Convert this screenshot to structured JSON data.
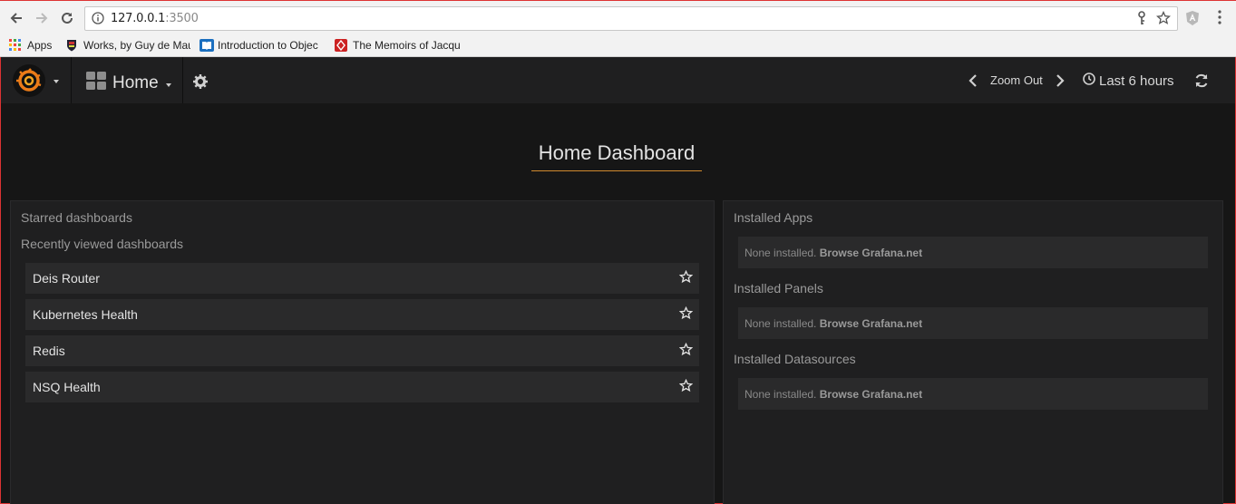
{
  "browser": {
    "url_host": "127.0.0.1",
    "url_port": ":3500",
    "icons": [
      "back-icon",
      "forward-icon",
      "reload-icon",
      "info-icon",
      "key-icon",
      "bookmark-star-icon",
      "extension-icon",
      "menu-icon"
    ]
  },
  "bookmarks": [
    {
      "label": "Apps",
      "icon": "apps-grid-icon"
    },
    {
      "label": "Works, by Guy de Mau",
      "icon": "shield-icon"
    },
    {
      "label": "Introduction to Objec",
      "icon": "book-icon"
    },
    {
      "label": "The Memoirs of Jacqu",
      "icon": "gutenberg-icon"
    }
  ],
  "grafana": {
    "home_label": "Home",
    "zoom_label": "Zoom Out",
    "time_label": "Last 6 hours",
    "dashboard_title": "Home Dashboard",
    "starred_heading": "Starred dashboards",
    "recent_heading": "Recently viewed dashboards",
    "recent_dashboards": [
      "Deis Router",
      "Kubernetes Health",
      "Redis",
      "NSQ Health"
    ],
    "installed": [
      {
        "heading": "Installed Apps",
        "empty_text": "None installed.",
        "link_text": "Browse Grafana.net"
      },
      {
        "heading": "Installed Panels",
        "empty_text": "None installed.",
        "link_text": "Browse Grafana.net"
      },
      {
        "heading": "Installed Datasources",
        "empty_text": "None installed.",
        "link_text": "Browse Grafana.net"
      }
    ],
    "colors": {
      "accent": "#eb7b18",
      "title_underline": "#d18a2e",
      "bg": "#161616",
      "panel": "#1f1f20",
      "row": "#2a2a2b"
    }
  }
}
